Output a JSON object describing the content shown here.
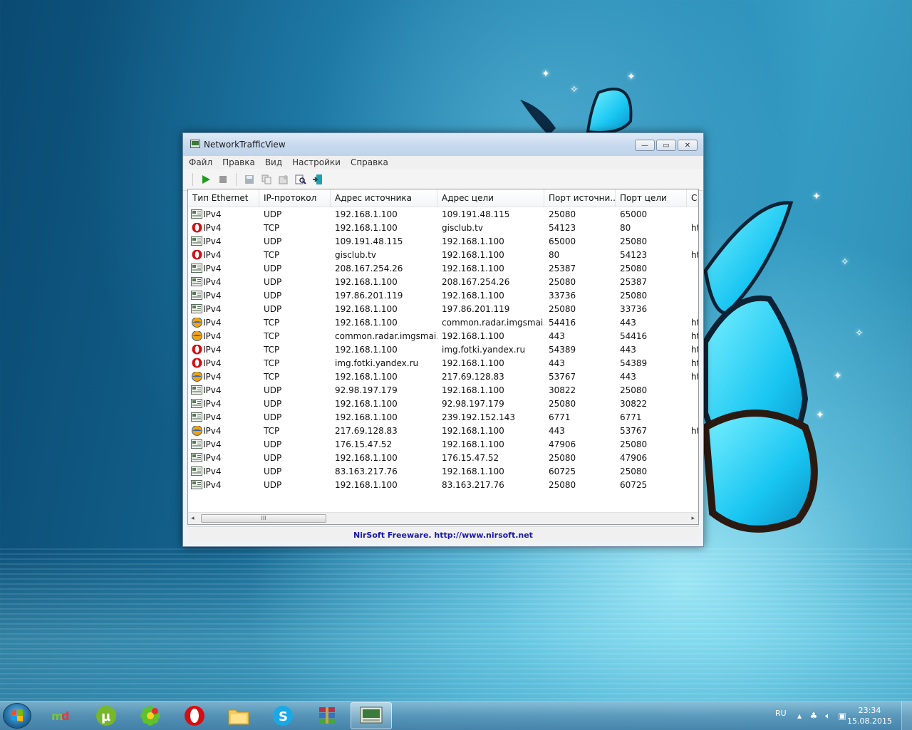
{
  "window": {
    "title": "NetworkTrafficView",
    "minimize_glyph": "—",
    "maximize_glyph": "▭",
    "close_glyph": "✕"
  },
  "menu": [
    "Файл",
    "Правка",
    "Вид",
    "Настройки",
    "Справка"
  ],
  "toolbar_icons": [
    "play-icon",
    "stop-icon",
    "save-icon",
    "copy-icon",
    "properties-icon",
    "find-icon",
    "exit-icon"
  ],
  "columns": [
    "Тип Ethernet",
    "IP-протокол",
    "Адрес источника",
    "Адрес цели",
    "Порт источни...",
    "Порт цели",
    "С..."
  ],
  "rows": [
    {
      "icon": "network",
      "eth": "IPv4",
      "proto": "UDP",
      "src": "192.168.1.100",
      "dst": "109.191.48.115",
      "sport": "25080",
      "dport": "65000",
      "svc": ""
    },
    {
      "icon": "opera",
      "eth": "IPv4",
      "proto": "TCP",
      "src": "192.168.1.100",
      "dst": "gisclub.tv",
      "sport": "54123",
      "dport": "80",
      "svc": "ht"
    },
    {
      "icon": "network",
      "eth": "IPv4",
      "proto": "UDP",
      "src": "109.191.48.115",
      "dst": "192.168.1.100",
      "sport": "65000",
      "dport": "25080",
      "svc": ""
    },
    {
      "icon": "opera",
      "eth": "IPv4",
      "proto": "TCP",
      "src": "gisclub.tv",
      "dst": "192.168.1.100",
      "sport": "80",
      "dport": "54123",
      "svc": "ht"
    },
    {
      "icon": "network",
      "eth": "IPv4",
      "proto": "UDP",
      "src": "208.167.254.26",
      "dst": "192.168.1.100",
      "sport": "25387",
      "dport": "25080",
      "svc": ""
    },
    {
      "icon": "network",
      "eth": "IPv4",
      "proto": "UDP",
      "src": "192.168.1.100",
      "dst": "208.167.254.26",
      "sport": "25080",
      "dport": "25387",
      "svc": ""
    },
    {
      "icon": "network",
      "eth": "IPv4",
      "proto": "UDP",
      "src": "197.86.201.119",
      "dst": "192.168.1.100",
      "sport": "33736",
      "dport": "25080",
      "svc": ""
    },
    {
      "icon": "network",
      "eth": "IPv4",
      "proto": "UDP",
      "src": "192.168.1.100",
      "dst": "197.86.201.119",
      "sport": "25080",
      "dport": "33736",
      "svc": ""
    },
    {
      "icon": "agent",
      "eth": "IPv4",
      "proto": "TCP",
      "src": "192.168.1.100",
      "dst": "common.radar.imgsmai...",
      "sport": "54416",
      "dport": "443",
      "svc": "ht"
    },
    {
      "icon": "agent",
      "eth": "IPv4",
      "proto": "TCP",
      "src": "common.radar.imgsmai...",
      "dst": "192.168.1.100",
      "sport": "443",
      "dport": "54416",
      "svc": "ht"
    },
    {
      "icon": "opera",
      "eth": "IPv4",
      "proto": "TCP",
      "src": "192.168.1.100",
      "dst": "img.fotki.yandex.ru",
      "sport": "54389",
      "dport": "443",
      "svc": "ht"
    },
    {
      "icon": "opera",
      "eth": "IPv4",
      "proto": "TCP",
      "src": "img.fotki.yandex.ru",
      "dst": "192.168.1.100",
      "sport": "443",
      "dport": "54389",
      "svc": "ht"
    },
    {
      "icon": "agent",
      "eth": "IPv4",
      "proto": "TCP",
      "src": "192.168.1.100",
      "dst": "217.69.128.83",
      "sport": "53767",
      "dport": "443",
      "svc": "ht"
    },
    {
      "icon": "network",
      "eth": "IPv4",
      "proto": "UDP",
      "src": "92.98.197.179",
      "dst": "192.168.1.100",
      "sport": "30822",
      "dport": "25080",
      "svc": ""
    },
    {
      "icon": "network",
      "eth": "IPv4",
      "proto": "UDP",
      "src": "192.168.1.100",
      "dst": "92.98.197.179",
      "sport": "25080",
      "dport": "30822",
      "svc": ""
    },
    {
      "icon": "network",
      "eth": "IPv4",
      "proto": "UDP",
      "src": "192.168.1.100",
      "dst": "239.192.152.143",
      "sport": "6771",
      "dport": "6771",
      "svc": ""
    },
    {
      "icon": "agent",
      "eth": "IPv4",
      "proto": "TCP",
      "src": "217.69.128.83",
      "dst": "192.168.1.100",
      "sport": "443",
      "dport": "53767",
      "svc": "ht"
    },
    {
      "icon": "network",
      "eth": "IPv4",
      "proto": "UDP",
      "src": "176.15.47.52",
      "dst": "192.168.1.100",
      "sport": "47906",
      "dport": "25080",
      "svc": ""
    },
    {
      "icon": "network",
      "eth": "IPv4",
      "proto": "UDP",
      "src": "192.168.1.100",
      "dst": "176.15.47.52",
      "sport": "25080",
      "dport": "47906",
      "svc": ""
    },
    {
      "icon": "network",
      "eth": "IPv4",
      "proto": "UDP",
      "src": "83.163.217.76",
      "dst": "192.168.1.100",
      "sport": "60725",
      "dport": "25080",
      "svc": ""
    },
    {
      "icon": "network",
      "eth": "IPv4",
      "proto": "UDP",
      "src": "192.168.1.100",
      "dst": "83.163.217.76",
      "sport": "25080",
      "dport": "60725",
      "svc": ""
    }
  ],
  "status": "NirSoft Freeware.  http://www.nirsoft.net",
  "scroll": {
    "thumb_grip": "III",
    "left_arrow": "◂",
    "right_arrow": "▸"
  },
  "taskbar": {
    "items": [
      {
        "name": "mediaget-icon",
        "active": false
      },
      {
        "name": "utorrent-icon",
        "active": false
      },
      {
        "name": "icq-icon",
        "active": false
      },
      {
        "name": "opera-icon",
        "active": false
      },
      {
        "name": "explorer-icon",
        "active": false
      },
      {
        "name": "skype-icon",
        "active": false
      },
      {
        "name": "winrar-icon",
        "active": false
      },
      {
        "name": "networktrafficview-icon",
        "active": true
      }
    ],
    "lang": "RU",
    "time": "23:34",
    "date": "15.08.2015"
  }
}
